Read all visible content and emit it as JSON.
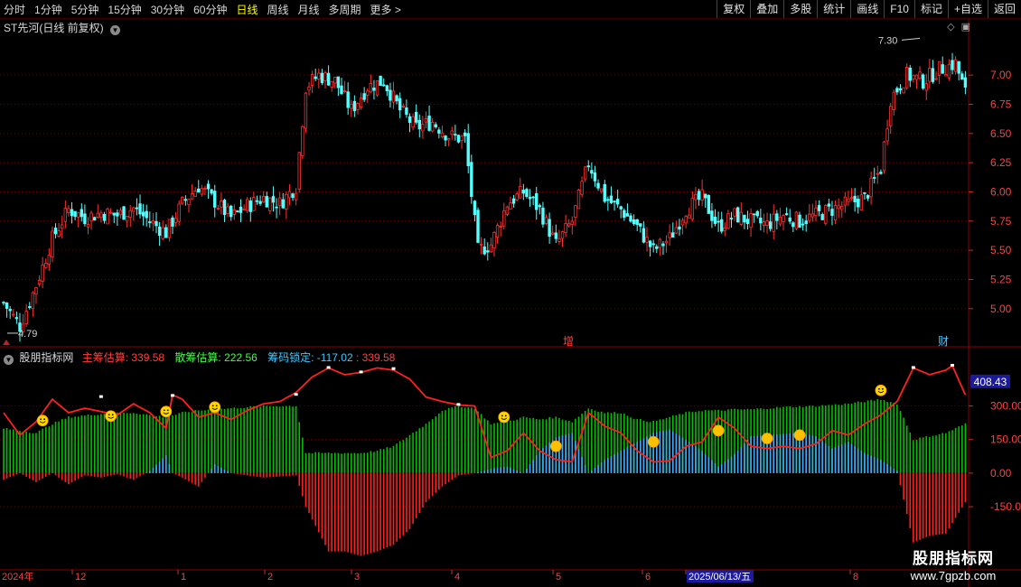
{
  "toolbar": {
    "periods": [
      "分时",
      "1分钟",
      "5分钟",
      "15分钟",
      "30分钟",
      "60分钟",
      "日线",
      "周线",
      "月线",
      "多周期",
      "更多 >"
    ],
    "active_period": "日线",
    "right_menu": [
      "复权",
      "叠加",
      "多股",
      "统计",
      "画线",
      "F10",
      "标记",
      "+自选",
      "返回"
    ]
  },
  "stock": {
    "title": "ST先河(日线 前复权)"
  },
  "indicator": {
    "name": "股朋指标网",
    "main_label": "主筹估算: 339.58",
    "scatter_label": "散筹估算: 222.56",
    "lock_label": "筹码锁定: -117.02",
    "extra_value": ": 339.58"
  },
  "markers": {
    "zeng": "增",
    "cai": "财"
  },
  "watermark": {
    "title": "股朋指标网",
    "url": "www.7gpzb.com"
  },
  "colors": {
    "up": "#ff3232",
    "down": "#54ffff",
    "green": "#00c000",
    "blue": "#3aaaff",
    "red": "#ff2020",
    "line": "#ff2020",
    "grid": "#700000"
  },
  "chart_data": [
    {
      "type": "candlestick",
      "title": "ST先河(日线 前复权)",
      "y_ticks": [
        7.0,
        6.75,
        6.5,
        6.25,
        6.0,
        5.75,
        5.5,
        5.25,
        5.0
      ],
      "ylim": [
        4.72,
        7.38
      ],
      "annotations": {
        "low": "4.79",
        "high": "7.30"
      },
      "x_labels": [
        "2024年",
        "12",
        "1",
        "2",
        "3",
        "4",
        "5",
        "6",
        "2025/06/13/五",
        "8"
      ],
      "close_path": [
        [
          0,
          5.05
        ],
        [
          5,
          4.85
        ],
        [
          10,
          5.2
        ],
        [
          15,
          5.6
        ],
        [
          20,
          5.85
        ],
        [
          25,
          5.78
        ],
        [
          30,
          5.82
        ],
        [
          35,
          5.8
        ],
        [
          40,
          5.86
        ],
        [
          45,
          5.75
        ],
        [
          50,
          5.65
        ],
        [
          55,
          5.9
        ],
        [
          60,
          6.05
        ],
        [
          65,
          5.92
        ],
        [
          70,
          5.78
        ],
        [
          75,
          5.88
        ],
        [
          80,
          5.95
        ],
        [
          85,
          5.9
        ],
        [
          90,
          6.05
        ],
        [
          93,
          6.9
        ],
        [
          97,
          7.0
        ],
        [
          102,
          6.95
        ],
        [
          107,
          6.7
        ],
        [
          112,
          6.9
        ],
        [
          117,
          6.95
        ],
        [
          122,
          6.7
        ],
        [
          127,
          6.55
        ],
        [
          132,
          6.6
        ],
        [
          137,
          6.48
        ],
        [
          142,
          6.45
        ],
        [
          146,
          5.5
        ],
        [
          150,
          5.55
        ],
        [
          155,
          5.9
        ],
        [
          160,
          6.0
        ],
        [
          165,
          5.85
        ],
        [
          170,
          5.55
        ],
        [
          175,
          5.75
        ],
        [
          180,
          6.25
        ],
        [
          185,
          5.95
        ],
        [
          190,
          5.85
        ],
        [
          195,
          5.7
        ],
        [
          200,
          5.5
        ],
        [
          205,
          5.6
        ],
        [
          210,
          5.85
        ],
        [
          215,
          5.95
        ],
        [
          220,
          5.7
        ],
        [
          225,
          5.8
        ],
        [
          230,
          5.75
        ],
        [
          235,
          5.72
        ],
        [
          240,
          5.8
        ],
        [
          245,
          5.75
        ],
        [
          250,
          5.8
        ],
        [
          255,
          5.85
        ],
        [
          260,
          5.9
        ],
        [
          265,
          5.95
        ],
        [
          270,
          6.2
        ],
        [
          273,
          6.8
        ],
        [
          278,
          7.0
        ],
        [
          283,
          6.95
        ],
        [
          288,
          7.05
        ],
        [
          293,
          7.1
        ],
        [
          296,
          6.85
        ]
      ]
    },
    {
      "type": "bar+line",
      "series": [
        {
          "name": "主筹估算",
          "path": [
            [
              0,
              270
            ],
            [
              5,
              170
            ],
            [
              10,
              230
            ],
            [
              15,
              330
            ],
            [
              20,
              270
            ],
            [
              25,
              290
            ],
            [
              30,
              275
            ],
            [
              35,
              260
            ],
            [
              40,
              310
            ],
            [
              45,
              270
            ],
            [
              50,
              200
            ],
            [
              52,
              350
            ],
            [
              55,
              330
            ],
            [
              60,
              250
            ],
            [
              65,
              270
            ],
            [
              70,
              240
            ],
            [
              75,
              280
            ],
            [
              80,
              310
            ],
            [
              85,
              320
            ],
            [
              90,
              360
            ],
            [
              95,
              430
            ],
            [
              100,
              470
            ],
            [
              105,
              440
            ],
            [
              110,
              450
            ],
            [
              115,
              470
            ],
            [
              120,
              460
            ],
            [
              125,
              420
            ],
            [
              130,
              340
            ],
            [
              135,
              320
            ],
            [
              140,
              305
            ],
            [
              145,
              300
            ],
            [
              150,
              70
            ],
            [
              155,
              100
            ],
            [
              160,
              180
            ],
            [
              165,
              100
            ],
            [
              170,
              60
            ],
            [
              175,
              50
            ],
            [
              180,
              270
            ],
            [
              185,
              210
            ],
            [
              190,
              180
            ],
            [
              195,
              100
            ],
            [
              200,
              50
            ],
            [
              205,
              55
            ],
            [
              210,
              120
            ],
            [
              215,
              140
            ],
            [
              220,
              250
            ],
            [
              225,
              200
            ],
            [
              230,
              120
            ],
            [
              235,
              110
            ],
            [
              240,
              120
            ],
            [
              245,
              110
            ],
            [
              250,
              130
            ],
            [
              255,
              190
            ],
            [
              260,
              170
            ],
            [
              265,
              220
            ],
            [
              270,
              260
            ],
            [
              275,
              320
            ],
            [
              280,
              470
            ],
            [
              285,
              440
            ],
            [
              290,
              460
            ],
            [
              292,
              480
            ],
            [
              296,
              350
            ]
          ]
        },
        {
          "name": "散筹估算",
          "path": [
            [
              0,
              200
            ],
            [
              10,
              180
            ],
            [
              15,
              220
            ],
            [
              20,
              250
            ],
            [
              30,
              265
            ],
            [
              40,
              270
            ],
            [
              50,
              250
            ],
            [
              55,
              270
            ],
            [
              60,
              280
            ],
            [
              70,
              290
            ],
            [
              80,
              300
            ],
            [
              90,
              300
            ],
            [
              93,
              90
            ],
            [
              100,
              90
            ],
            [
              110,
              90
            ],
            [
              115,
              100
            ],
            [
              120,
              120
            ],
            [
              125,
              170
            ],
            [
              130,
              220
            ],
            [
              135,
              280
            ],
            [
              140,
              300
            ],
            [
              145,
              290
            ],
            [
              150,
              220
            ],
            [
              155,
              230
            ],
            [
              160,
              250
            ],
            [
              165,
              240
            ],
            [
              170,
              250
            ],
            [
              175,
              230
            ],
            [
              180,
              290
            ],
            [
              185,
              270
            ],
            [
              190,
              270
            ],
            [
              195,
              240
            ],
            [
              200,
              230
            ],
            [
              205,
              250
            ],
            [
              210,
              270
            ],
            [
              215,
              280
            ],
            [
              220,
              280
            ],
            [
              225,
              285
            ],
            [
              230,
              285
            ],
            [
              235,
              290
            ],
            [
              240,
              295
            ],
            [
              250,
              300
            ],
            [
              260,
              310
            ],
            [
              270,
              330
            ],
            [
              275,
              310
            ],
            [
              280,
              150
            ],
            [
              290,
              180
            ],
            [
              296,
              220
            ]
          ]
        },
        {
          "name": "筹码锁定",
          "path": [
            [
              0,
              -30
            ],
            [
              5,
              0
            ],
            [
              10,
              -40
            ],
            [
              15,
              0
            ],
            [
              20,
              -50
            ],
            [
              25,
              -10
            ],
            [
              30,
              -20
            ],
            [
              35,
              -5
            ],
            [
              40,
              -30
            ],
            [
              45,
              10
            ],
            [
              50,
              80
            ],
            [
              52,
              0
            ],
            [
              55,
              -20
            ],
            [
              60,
              -60
            ],
            [
              65,
              40
            ],
            [
              70,
              0
            ],
            [
              75,
              -10
            ],
            [
              80,
              -20
            ],
            [
              85,
              -15
            ],
            [
              90,
              -10
            ],
            [
              93,
              -150
            ],
            [
              100,
              -350
            ],
            [
              105,
              -350
            ],
            [
              110,
              -370
            ],
            [
              115,
              -350
            ],
            [
              120,
              -320
            ],
            [
              125,
              -250
            ],
            [
              130,
              -130
            ],
            [
              135,
              -60
            ],
            [
              140,
              -10
            ],
            [
              145,
              0
            ],
            [
              150,
              20
            ],
            [
              155,
              30
            ],
            [
              160,
              0
            ],
            [
              165,
              100
            ],
            [
              170,
              160
            ],
            [
              175,
              180
            ],
            [
              180,
              0
            ],
            [
              185,
              60
            ],
            [
              190,
              100
            ],
            [
              195,
              140
            ],
            [
              200,
              180
            ],
            [
              205,
              195
            ],
            [
              210,
              150
            ],
            [
              215,
              100
            ],
            [
              220,
              30
            ],
            [
              225,
              85
            ],
            [
              230,
              165
            ],
            [
              235,
              170
            ],
            [
              240,
              175
            ],
            [
              245,
              180
            ],
            [
              250,
              165
            ],
            [
              255,
              110
            ],
            [
              260,
              140
            ],
            [
              265,
              90
            ],
            [
              270,
              60
            ],
            [
              275,
              10
            ],
            [
              280,
              -310
            ],
            [
              285,
              -280
            ],
            [
              290,
              -270
            ],
            [
              296,
              -130
            ]
          ]
        }
      ],
      "y_ticks": [
        300.0,
        150.0,
        0.0,
        -150.0
      ],
      "ylim": [
        -420,
        500
      ],
      "current_value": "408.43"
    }
  ]
}
